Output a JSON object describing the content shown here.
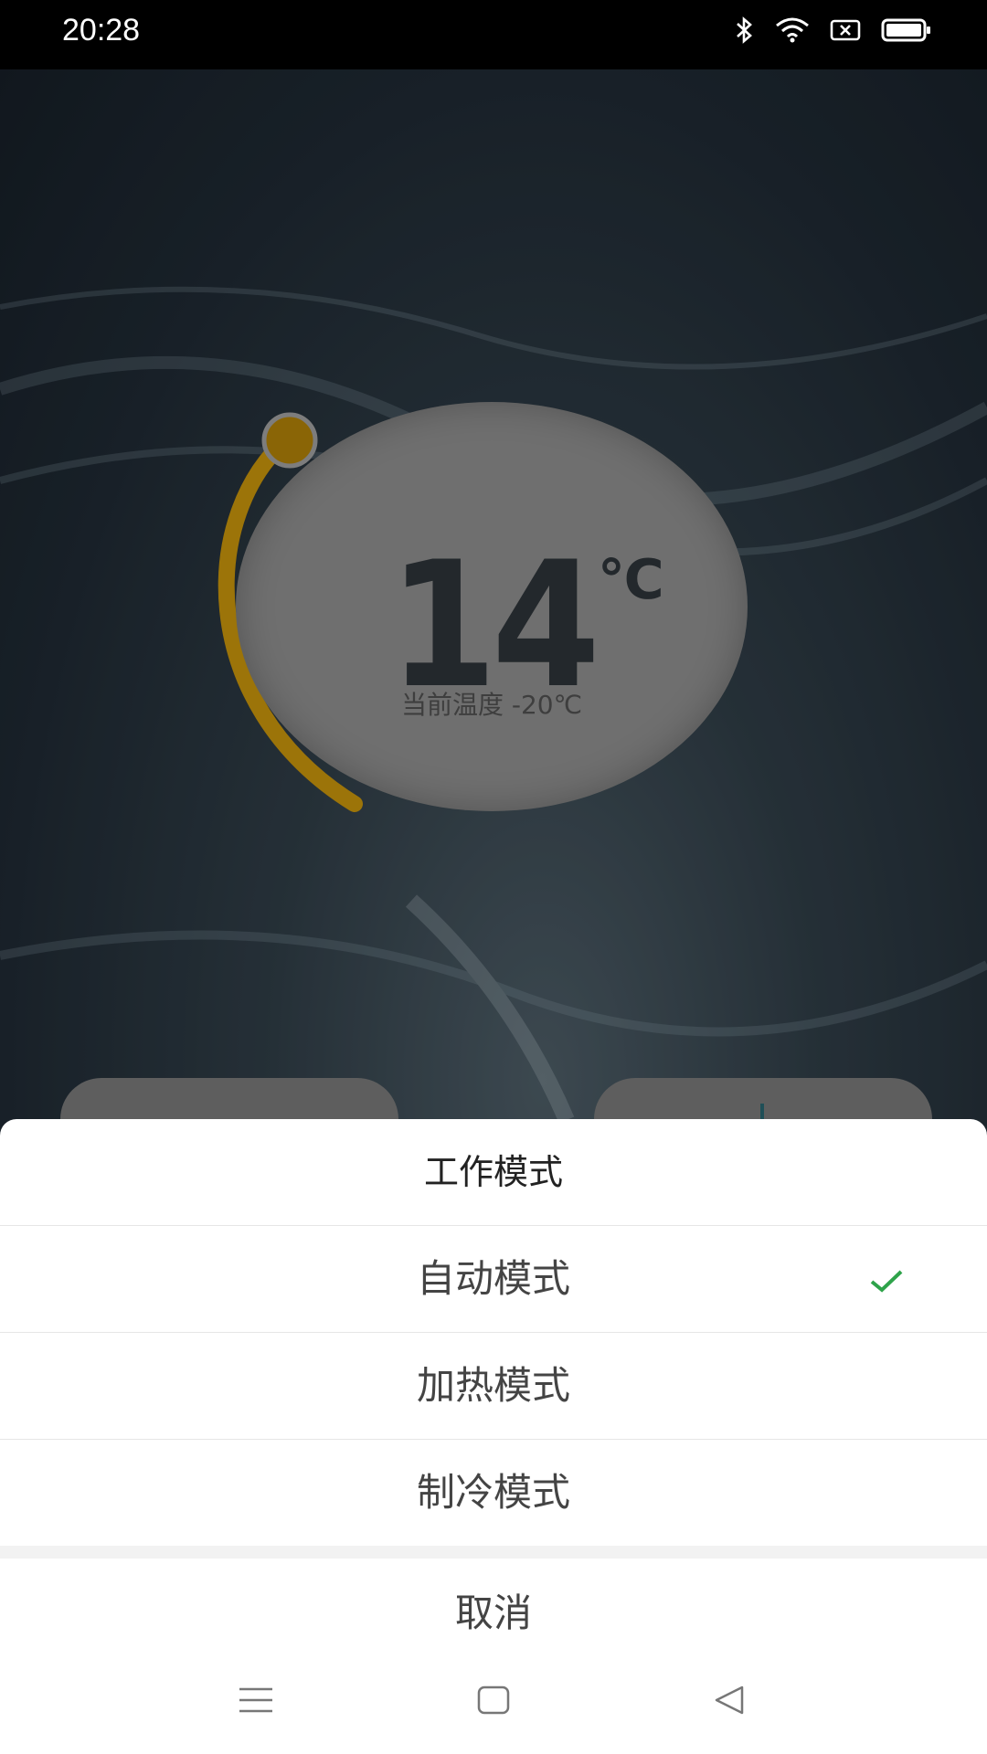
{
  "status_bar": {
    "time": "20:28",
    "icons": [
      "bluetooth-icon",
      "wifi-icon",
      "sim-icon",
      "battery-icon"
    ]
  },
  "thermostat": {
    "set_temperature": "14",
    "unit": "℃",
    "current_temperature_label": "当前温度 -20℃",
    "accent_color": "#b5870a"
  },
  "mode_sheet": {
    "title": "工作模式",
    "options": [
      {
        "label": "自动模式",
        "selected": true
      },
      {
        "label": "加热模式",
        "selected": false
      },
      {
        "label": "制冷模式",
        "selected": false
      }
    ],
    "cancel_label": "取消",
    "check_color": "#2ea34a"
  },
  "nav_bar": {
    "icons": [
      "menu-icon",
      "home-icon",
      "back-icon"
    ]
  }
}
